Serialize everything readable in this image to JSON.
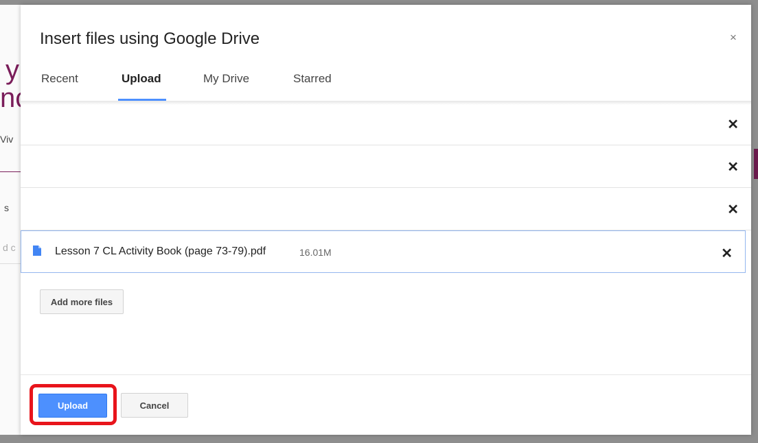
{
  "background": {
    "fragments": [
      "y",
      "nc",
      "Viv",
      "s",
      "d c"
    ]
  },
  "dialog": {
    "title": "Insert files using Google Drive",
    "close_glyph": "×"
  },
  "tabs": [
    {
      "label": "Recent",
      "active": false
    },
    {
      "label": "Upload",
      "active": true
    },
    {
      "label": "My Drive",
      "active": false
    },
    {
      "label": "Starred",
      "active": false
    }
  ],
  "rows": [
    {
      "name": "",
      "size": "",
      "remove_glyph": "✕"
    },
    {
      "name": "",
      "size": "",
      "remove_glyph": "✕"
    },
    {
      "name": "",
      "size": "",
      "remove_glyph": "✕"
    },
    {
      "name": "Lesson 7 CL Activity Book (page 73-79).pdf",
      "size": "16.01M",
      "remove_glyph": "✕",
      "icon": "file-icon"
    }
  ],
  "actions": {
    "add_more_label": "Add more files",
    "upload_label": "Upload",
    "cancel_label": "Cancel"
  },
  "colors": {
    "accent": "#4d90fe",
    "highlight": "#e8141b",
    "file_icon": "#4285f4"
  }
}
